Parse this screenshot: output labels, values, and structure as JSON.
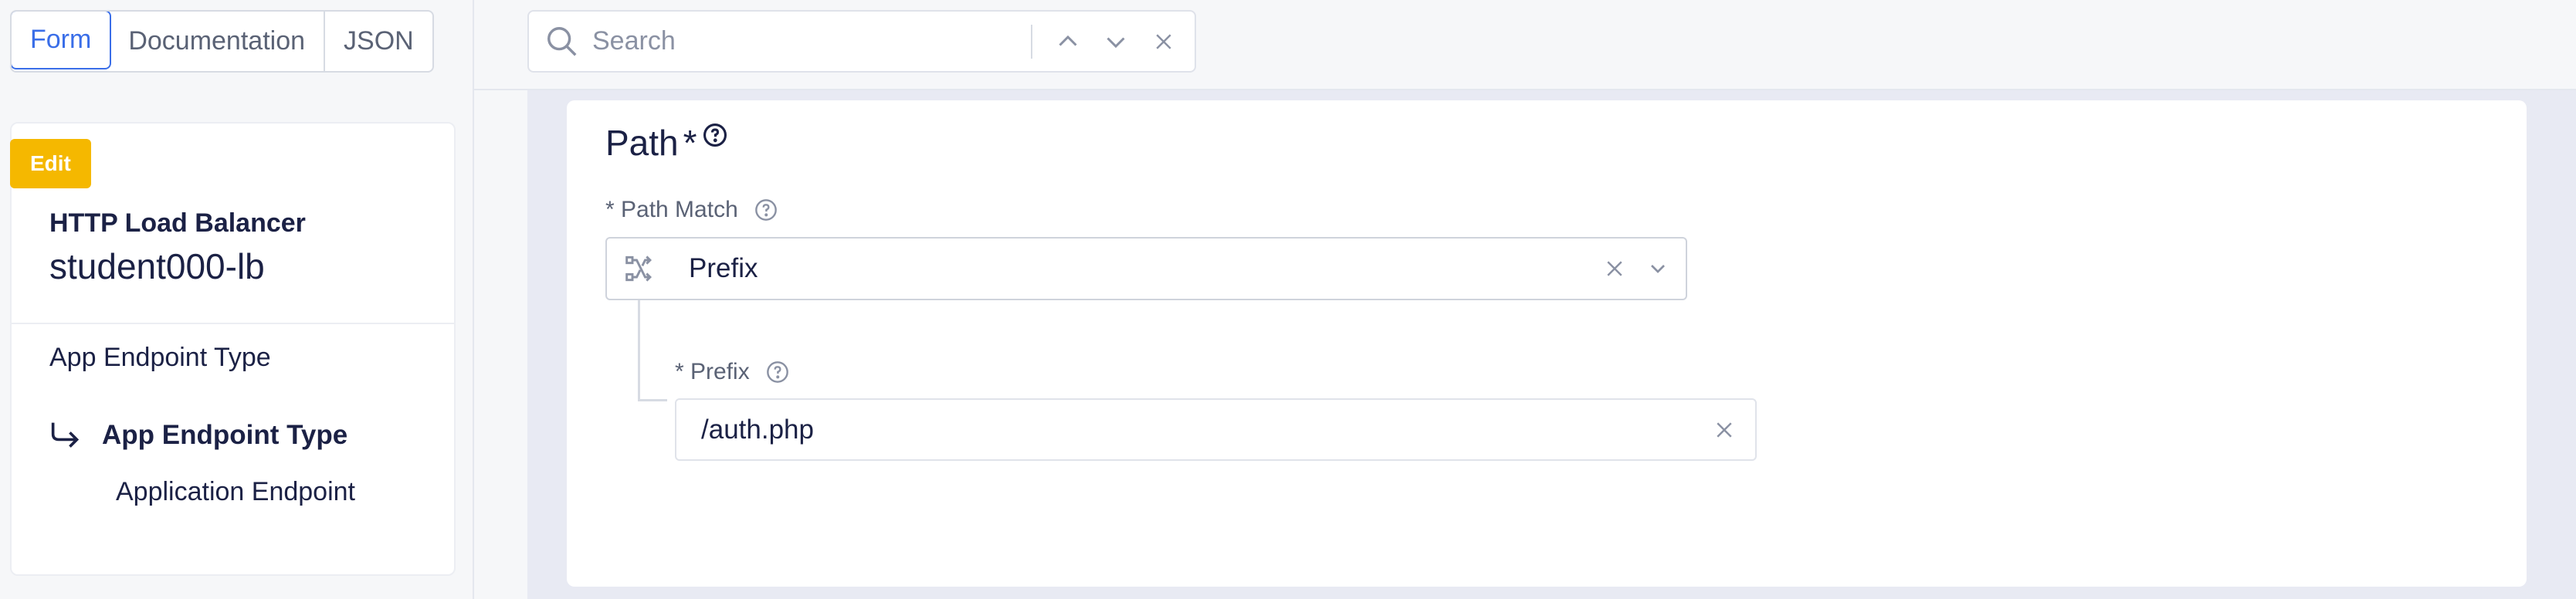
{
  "toolbar": {
    "tabs": [
      {
        "label": "Form",
        "active": true
      },
      {
        "label": "Documentation",
        "active": false
      },
      {
        "label": "JSON",
        "active": false
      }
    ],
    "search": {
      "placeholder": "Search"
    }
  },
  "sidebar": {
    "badge": "Edit",
    "object_type": "HTTP Load Balancer",
    "object_name": "student000-lb",
    "nav": {
      "section": "App Endpoint Type",
      "current": "App Endpoint Type",
      "child": "Application Endpoint"
    }
  },
  "form": {
    "section_title": "Path",
    "section_required": "*",
    "path_match": {
      "label": "* Path Match",
      "value": "Prefix"
    },
    "prefix": {
      "label": "* Prefix",
      "value": "/auth.php"
    }
  },
  "colors": {
    "accent": "#3a6ee8",
    "badge": "#f5b800",
    "text": "#1b2145"
  },
  "icons": {
    "search": "search-icon",
    "prev": "chevron-up-icon",
    "next": "chevron-down-icon",
    "close": "close-icon",
    "help": "question-circle-icon",
    "path": "route-icon",
    "arrow": "corner-down-right-icon"
  }
}
